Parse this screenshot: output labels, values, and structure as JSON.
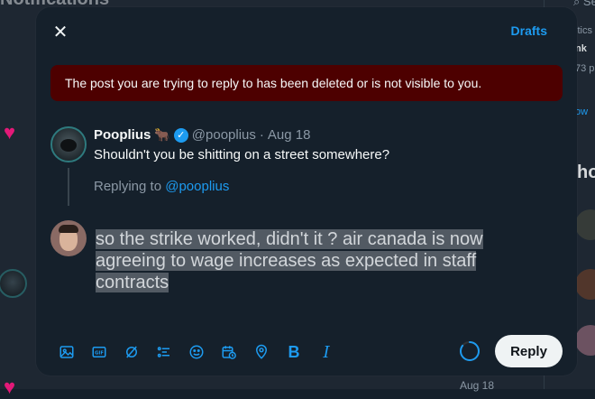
{
  "background": {
    "page_title": "Notifications",
    "search_text": "Sea",
    "right_snippets": [
      "itics",
      "nk",
      "73 p",
      "ow"
    ],
    "right_heading": "ho",
    "bottom_date": "Aug 18"
  },
  "modal": {
    "close_label": "✕",
    "drafts_label": "Drafts",
    "error_message": "The post you are trying to reply to has been deleted or is not visible to you.",
    "original_post": {
      "author_name": "Pooplius",
      "author_emoji": "🐂",
      "verified_mark": "✓",
      "handle": "@pooplius",
      "separator": "·",
      "date": "Aug 18",
      "text": "Shouldn't you be shitting on a street somewhere?"
    },
    "replying_to": {
      "prefix": "Replying to",
      "handle": "@pooplius"
    },
    "compose": {
      "text": "so the strike worked, didn't it ? air canada is now agreeing to wage increases as expected in staff contracts"
    },
    "toolbar": {
      "icons": [
        "image-icon",
        "gif-icon",
        "grok-icon",
        "poll-icon",
        "emoji-icon",
        "schedule-icon",
        "location-icon",
        "bold-icon",
        "italic-icon"
      ],
      "bold_label": "B",
      "italic_label": "I"
    },
    "char_progress": 0.85,
    "reply_label": "Reply"
  },
  "colors": {
    "accent": "#1d9bf0",
    "error_bg": "#4d0000",
    "modal_bg": "#15202b",
    "reply_button_bg": "#eff3f4"
  }
}
